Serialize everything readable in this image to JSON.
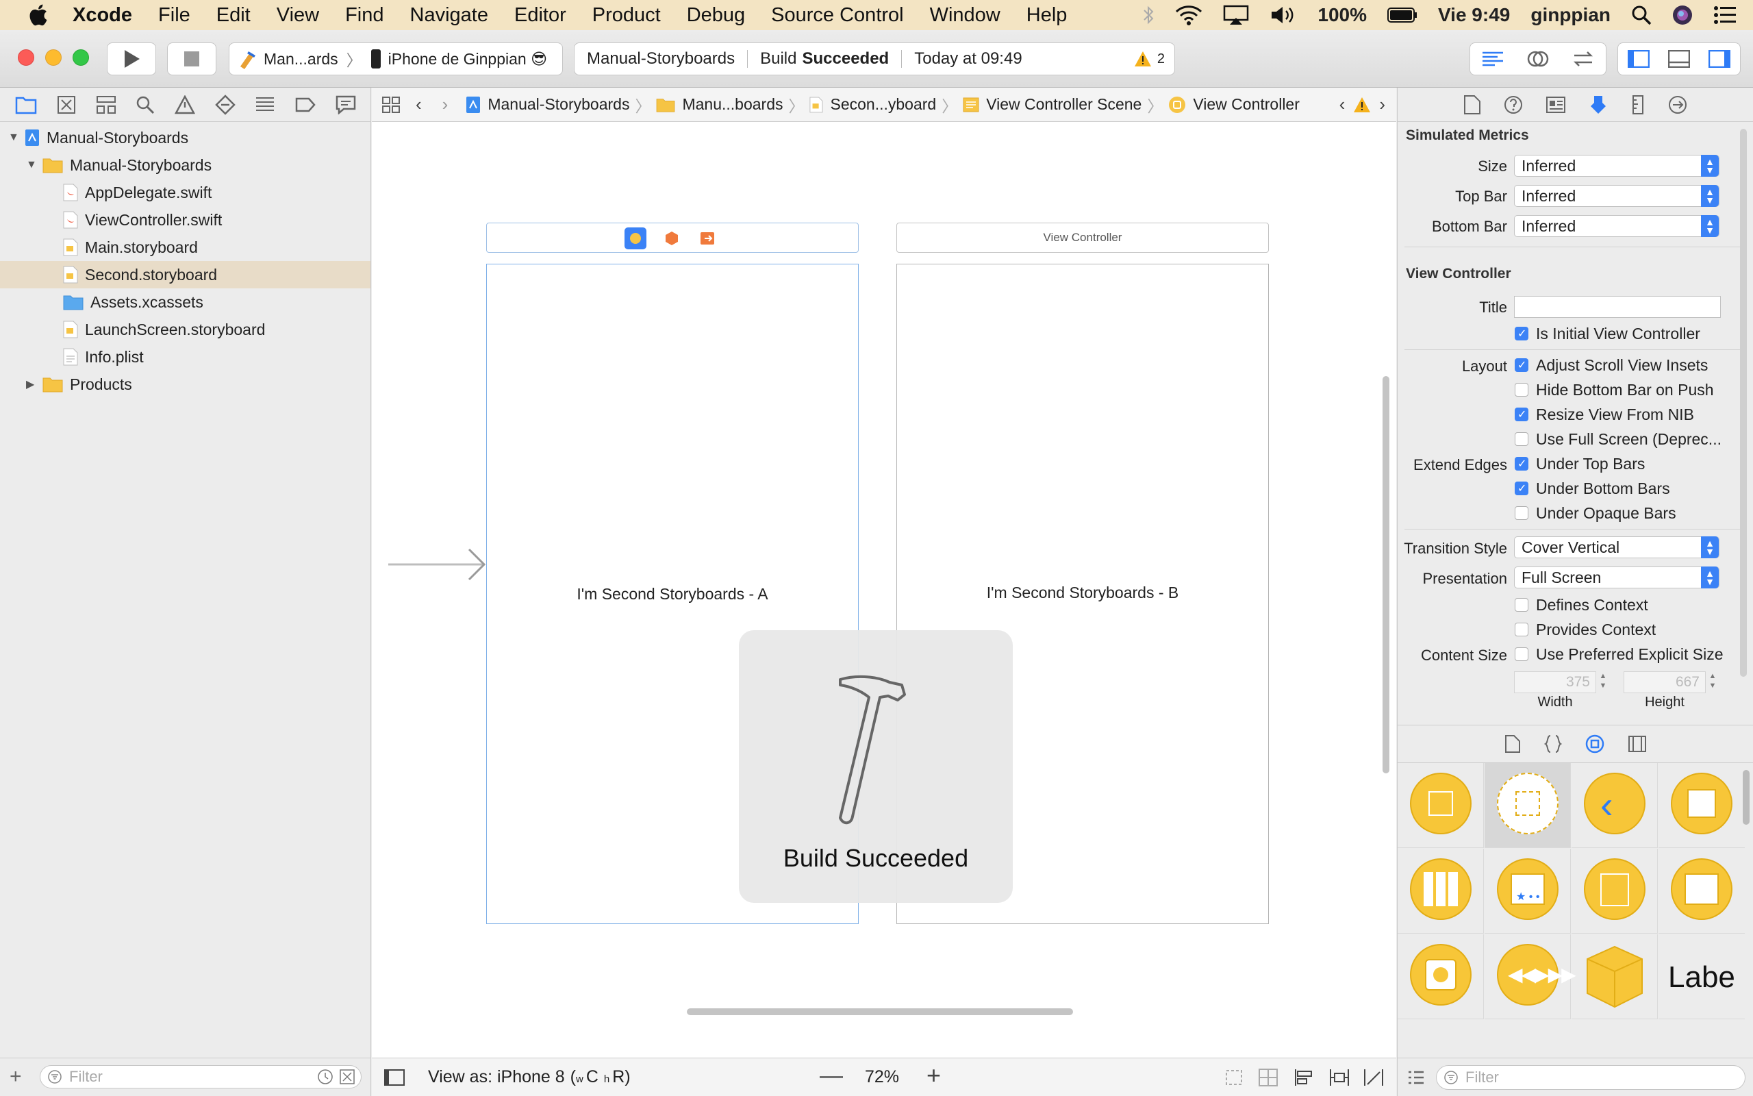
{
  "menubar": {
    "app": "Xcode",
    "items": [
      "File",
      "Edit",
      "View",
      "Find",
      "Navigate",
      "Editor",
      "Product",
      "Debug",
      "Source Control",
      "Window",
      "Help"
    ],
    "battery": "100%",
    "clock": "Vie 9:49",
    "user": "ginppian"
  },
  "toolbar": {
    "scheme": "Man...ards",
    "device": "iPhone de Ginppian 😎",
    "status_project": "Manual-Storyboards",
    "status_build_prefix": "Build",
    "status_build": "Succeeded",
    "status_time": "Today at 09:49",
    "warnings": "2"
  },
  "navigator": {
    "items": [
      {
        "label": "Manual-Storyboards",
        "kind": "project"
      },
      {
        "label": "Manual-Storyboards",
        "kind": "folder"
      },
      {
        "label": "AppDelegate.swift",
        "kind": "swift"
      },
      {
        "label": "ViewController.swift",
        "kind": "swift"
      },
      {
        "label": "Main.storyboard",
        "kind": "storyboard"
      },
      {
        "label": "Second.storyboard",
        "kind": "storyboard"
      },
      {
        "label": "Assets.xcassets",
        "kind": "assets"
      },
      {
        "label": "LaunchScreen.storyboard",
        "kind": "storyboard"
      },
      {
        "label": "Info.plist",
        "kind": "plist"
      },
      {
        "label": "Products",
        "kind": "folder"
      }
    ],
    "selected_index": 5,
    "filter_placeholder": "Filter"
  },
  "jumpbar": {
    "crumbs": [
      "Manual-Storyboards",
      "Manu...boards",
      "Secon...yboard",
      "View Controller Scene",
      "View Controller"
    ]
  },
  "canvas": {
    "scene_a_text": "I'm Second Storyboards - A",
    "scene_b_title": "View Controller",
    "scene_b_text": "I'm Second Storyboards - B",
    "hud_text": "Build Succeeded"
  },
  "editor_bottom": {
    "view_as": "View as: iPhone 8",
    "size_class_w": "w",
    "size_class_c": "C",
    "size_class_h": "h",
    "size_class_r": "R",
    "zoom": "72%"
  },
  "inspector": {
    "simulated_metrics": {
      "title": "Simulated Metrics",
      "size_label": "Size",
      "size_value": "Inferred",
      "topbar_label": "Top Bar",
      "topbar_value": "Inferred",
      "bottombar_label": "Bottom Bar",
      "bottombar_value": "Inferred"
    },
    "view_controller": {
      "title": "View Controller",
      "title_label": "Title",
      "title_value": "",
      "initial": "Is Initial View Controller",
      "layout_label": "Layout",
      "adjust_scroll": "Adjust Scroll View Insets",
      "hide_bottom": "Hide Bottom Bar on Push",
      "resize_nib": "Resize View From NIB",
      "full_screen": "Use Full Screen (Deprec...",
      "extend_edges_label": "Extend Edges",
      "under_top": "Under Top Bars",
      "under_bottom": "Under Bottom Bars",
      "under_opaque": "Under Opaque Bars",
      "transition_label": "Transition Style",
      "transition_value": "Cover Vertical",
      "presentation_label": "Presentation",
      "presentation_value": "Full Screen",
      "defines_context": "Defines Context",
      "provides_context": "Provides Context",
      "content_size_label": "Content Size",
      "preferred_size": "Use Preferred Explicit Size",
      "width_value": "375",
      "height_value": "667",
      "width_label": "Width",
      "height_label": "Height"
    },
    "checks": {
      "initial": true,
      "adjust_scroll": true,
      "hide_bottom": false,
      "resize_nib": true,
      "full_screen": false,
      "under_top": true,
      "under_bottom": true,
      "under_opaque": false,
      "defines_context": false,
      "provides_context": false,
      "preferred_size": false
    },
    "library_label_item": "Labe",
    "library_filter_placeholder": "Filter"
  },
  "colors": {
    "menubar": "#f3e4c3",
    "accent": "#3b82f6",
    "library_yellow": "#f7c638",
    "warning": "#f5b21c"
  }
}
